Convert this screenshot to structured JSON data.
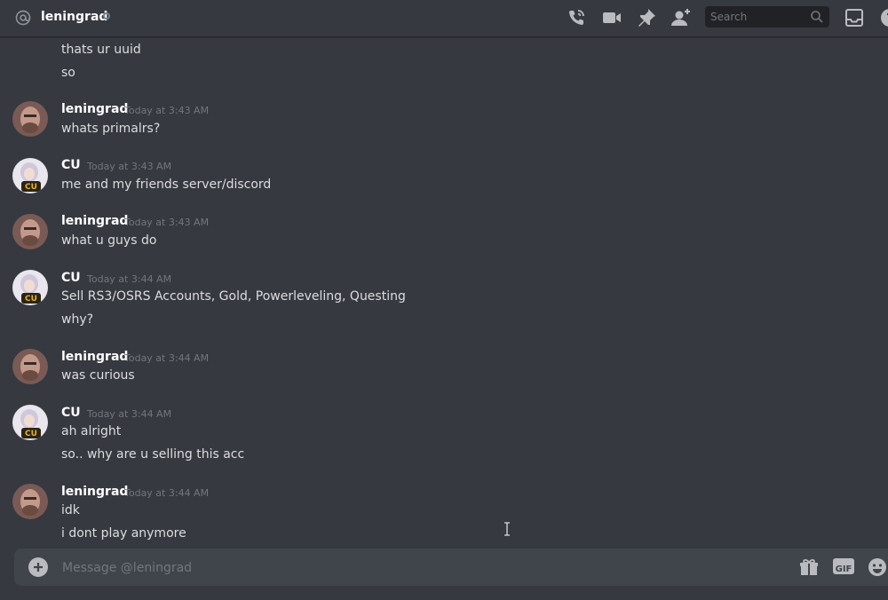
{
  "header": {
    "channel_name": "leningrad",
    "search_placeholder": "Search",
    "icons": [
      "at-icon",
      "call-icon",
      "video-icon",
      "pin-icon",
      "add-friend-icon",
      "search-icon",
      "inbox-icon",
      "help-icon"
    ]
  },
  "messages": [
    {
      "lines": [
        "thats ur uuid",
        "so"
      ]
    },
    {
      "author": "leningrad",
      "timestamp": "Today at 3:43 AM",
      "lines": [
        "whats primalrs?"
      ]
    },
    {
      "author": "CU",
      "timestamp": "Today at 3:43 AM",
      "lines": [
        "me and my friends server/discord"
      ]
    },
    {
      "author": "leningrad",
      "timestamp": "Today at 3:43 AM",
      "lines": [
        "what u guys do"
      ]
    },
    {
      "author": "CU",
      "timestamp": "Today at 3:44 AM",
      "lines": [
        "Sell RS3/OSRS Accounts, Gold, Powerleveling, Questing",
        "why?"
      ]
    },
    {
      "author": "leningrad",
      "timestamp": "Today at 3:44 AM",
      "lines": [
        "was curious"
      ]
    },
    {
      "author": "CU",
      "timestamp": "Today at 3:44 AM",
      "lines": [
        "ah alright",
        "so.. why are u selling this acc"
      ]
    },
    {
      "author": "leningrad",
      "timestamp": "Today at 3:44 AM",
      "lines": [
        "idk",
        "i dont play anymore"
      ]
    }
  ],
  "composer": {
    "placeholder": "Message @leningrad",
    "gif_label": "GIF"
  },
  "colors": {
    "background": "#36393f",
    "text": "#dcddde",
    "muted": "#72767d",
    "input_bg": "#40444b"
  }
}
